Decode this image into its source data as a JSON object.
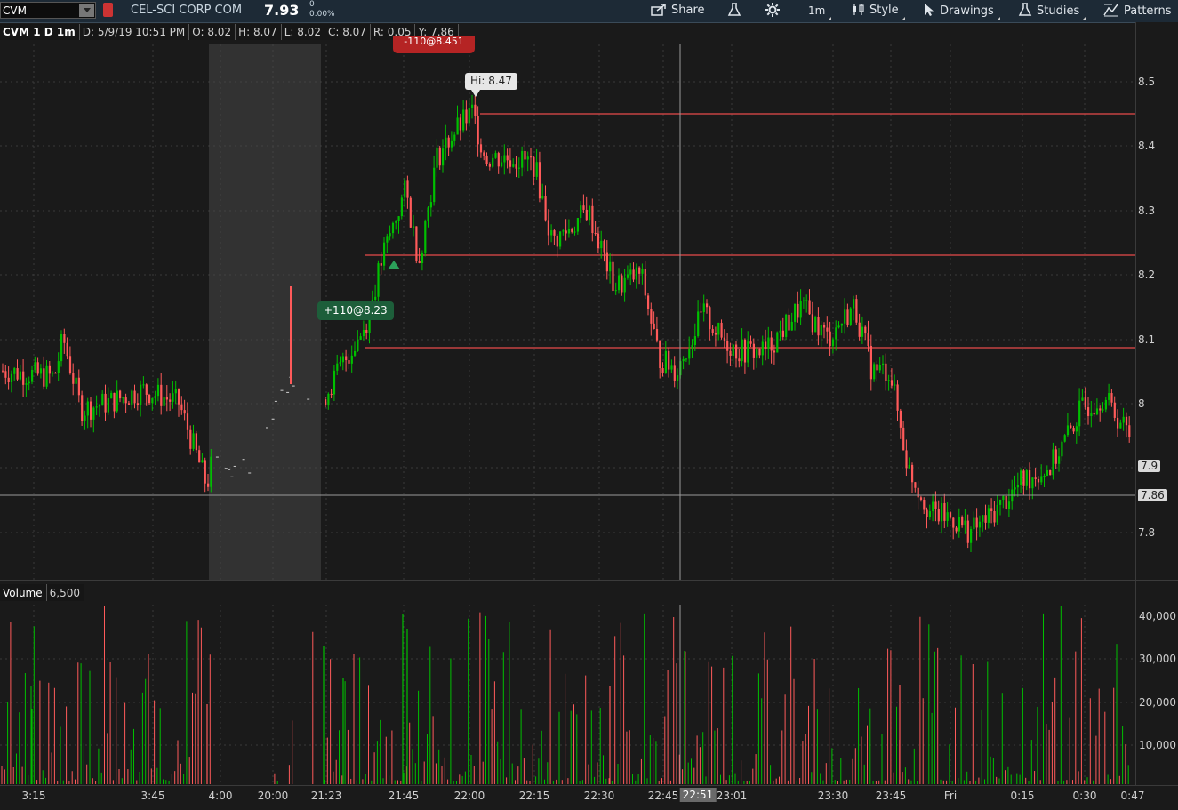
{
  "toolbar": {
    "symbol": "CVM",
    "alert": "!",
    "company": "CEL-SCI CORP COM",
    "last": "7.93",
    "change_abs": "0",
    "change_pct": "0.00%",
    "share_label": "Share",
    "timeframe_label": "1m",
    "style_label": "Style",
    "drawings_label": "Drawings",
    "studies_label": "Studies",
    "patterns_label": "Patterns"
  },
  "info_bar": {
    "title": "CVM 1 D 1m",
    "date": "D: 5/9/19 10:51 PM",
    "open": "O: 8.02",
    "high": "H: 8.07",
    "low": "L: 8.02",
    "close": "C: 8.07",
    "range": "R: 0.05",
    "y": "Y: 7.86"
  },
  "price_axis": {
    "ticks": [
      "8.5",
      "8.4",
      "8.3",
      "8.2",
      "8.1",
      "8",
      "7.9",
      "7.86",
      "7.8"
    ],
    "current_box": "7.9",
    "cursor_box": "7.86"
  },
  "annotations": {
    "high_label": "Hi: 8.47",
    "buy_fill": "+110@8.23",
    "sell_fill": "-110@8.451"
  },
  "volume": {
    "label": "Volume",
    "value": "6,500",
    "axis_ticks": [
      "40,000",
      "30,000",
      "20,000",
      "10,000"
    ]
  },
  "time_axis": {
    "labels": [
      "3:15",
      "3:45",
      "4:00",
      "20:00",
      "21:23",
      "21:45",
      "22:00",
      "22:15",
      "22:30",
      "22:45",
      "23:01",
      "23:30",
      "23:45",
      "Fri",
      "0:15",
      "0:30",
      "0:47"
    ],
    "cursor_time": "22:51"
  },
  "colors": {
    "up": "#00c000",
    "down": "#ff5a5a",
    "hline": "#e84a4a",
    "grid": "#3a3a3a"
  }
}
